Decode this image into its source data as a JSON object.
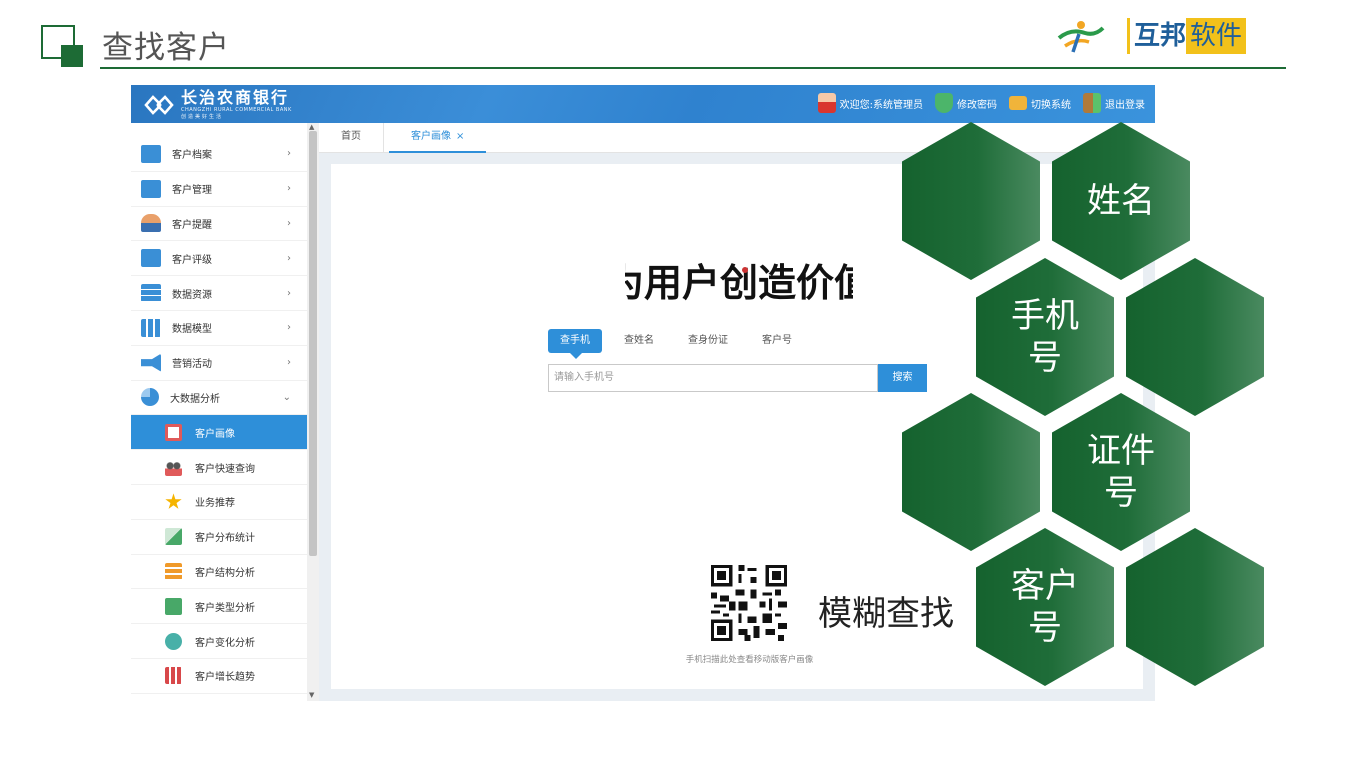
{
  "slide": {
    "title": "查找客户",
    "brand_left": "互邦",
    "brand_right": "软件",
    "accent_color": "#1d6b35"
  },
  "app": {
    "bank_name": "长治农商银行",
    "bank_name_en": "CHANGZHI RURAL COMMERCIAL BANK",
    "bank_slogan": "创造美好生活",
    "user_actions": [
      {
        "label": "欢迎您:系统管理员",
        "icon": "user-icon"
      },
      {
        "label": "修改密码",
        "icon": "shield-icon"
      },
      {
        "label": "切换系统",
        "icon": "switch-icon"
      },
      {
        "label": "退出登录",
        "icon": "logout-icon"
      }
    ],
    "menu": [
      {
        "label": "客户档案",
        "icon": "profile-icon",
        "color": "#3a8fd6"
      },
      {
        "label": "客户管理",
        "icon": "contacts-icon",
        "color": "#3a8fd6"
      },
      {
        "label": "客户提醒",
        "icon": "person-icon",
        "color": "#e07b3a"
      },
      {
        "label": "客户评级",
        "icon": "rating-icon",
        "color": "#3a8fd6"
      },
      {
        "label": "数据资源",
        "icon": "database-icon",
        "color": "#3a8fd6"
      },
      {
        "label": "数据模型",
        "icon": "bar-chart-icon",
        "color": "#3a8fd6"
      },
      {
        "label": "营销活动",
        "icon": "megaphone-icon",
        "color": "#3a8fd6"
      },
      {
        "label": "大数据分析",
        "icon": "pie-chart-icon",
        "color": "#3a8fd6"
      }
    ],
    "submenu": [
      {
        "label": "客户画像",
        "icon": "portrait-icon",
        "color": "#e05a5a"
      },
      {
        "label": "客户快速查询",
        "icon": "group-icon",
        "color": "#555555"
      },
      {
        "label": "业务推荐",
        "icon": "star-icon",
        "color": "#f5b400"
      },
      {
        "label": "客户分布统计",
        "icon": "map-icon",
        "color": "#48a868"
      },
      {
        "label": "客户结构分析",
        "icon": "structure-icon",
        "color": "#f09a2a"
      },
      {
        "label": "客户类型分析",
        "icon": "type-icon",
        "color": "#48a868"
      },
      {
        "label": "客户变化分析",
        "icon": "wave-icon",
        "color": "#48b0a8"
      },
      {
        "label": "客户增长趋势",
        "icon": "growth-icon",
        "color": "#d8484a"
      }
    ],
    "tabs": {
      "home": "首页",
      "current": "客户画像",
      "close": "×"
    },
    "search_tabs": [
      "查手机",
      "查姓名",
      "查身份证",
      "客户号"
    ],
    "search": {
      "placeholder": "请输入手机号",
      "button": "搜索"
    },
    "qr_caption": "手机扫描此处查看移动版客户画像",
    "calligraphy": "为用户创造价值"
  },
  "callout": {
    "fuzzy_label": "模糊查找",
    "hexes": [
      "姓名",
      "手机号",
      "证件号",
      "客户号"
    ]
  }
}
